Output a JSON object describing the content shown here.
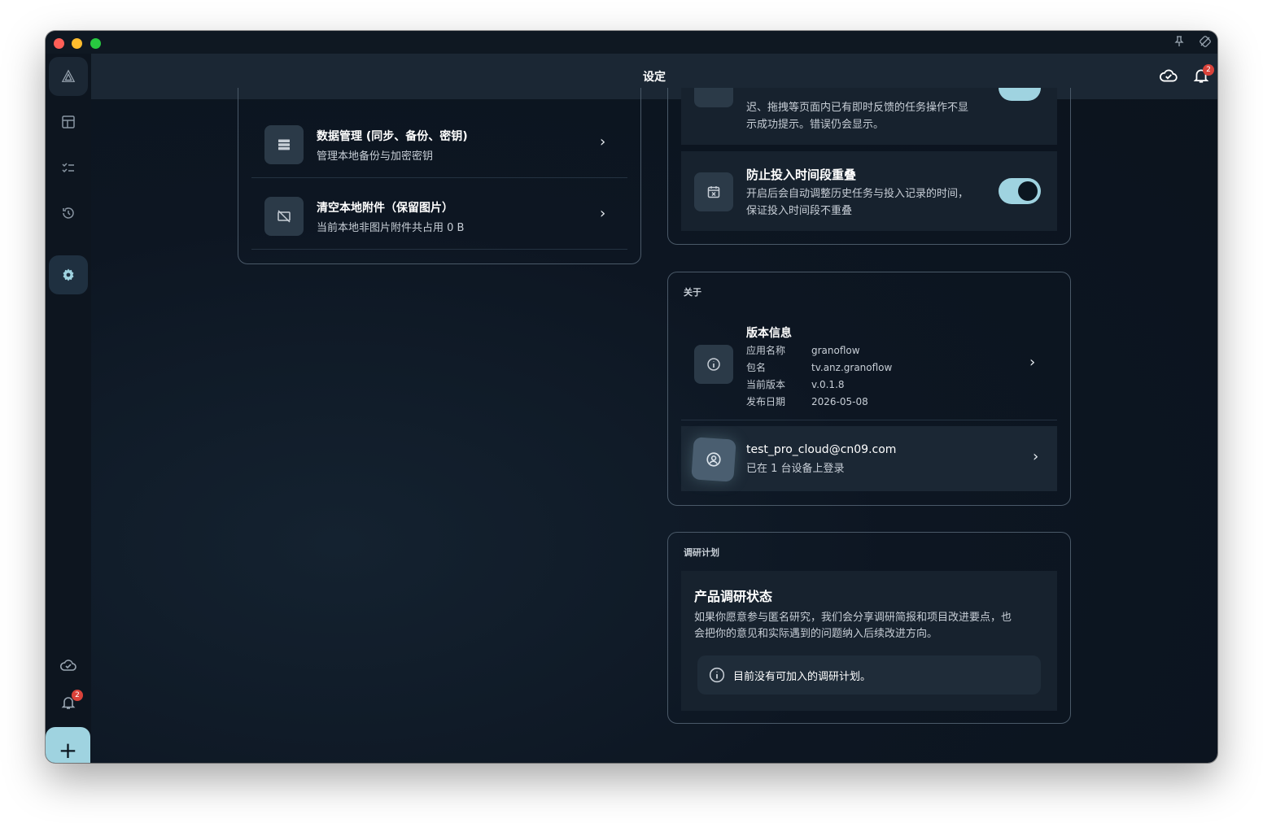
{
  "header": {
    "title": "设定"
  },
  "sidebar": {
    "notification_badge": "2"
  },
  "header_actions": {
    "notification_badge": "2"
  },
  "data_card": {
    "items": [
      {
        "title": "数据管理 (同步、备份、密钥)",
        "subtitle": "管理本地备份与加密密钥"
      },
      {
        "title": "清空本地附件（保留图片）",
        "subtitle": "当前本地非图片附件共占用 0 B"
      }
    ]
  },
  "behavior_card": {
    "partial_item": {
      "line1": "迟、拖拽等页面内已有即时反馈的任务操作不显",
      "line2": "示成功提示。错误仍会显示。"
    },
    "overlap_item": {
      "title": "防止投入时间段重叠",
      "line1": "开启后会自动调整历史任务与投入记录的时间，",
      "line2": "保证投入时间段不重叠",
      "enabled": true
    }
  },
  "about_card": {
    "label": "关于",
    "version": {
      "title": "版本信息",
      "rows": [
        {
          "key": "应用名称",
          "value": "granoflow"
        },
        {
          "key": "包名",
          "value": "tv.anz.granoflow"
        },
        {
          "key": "当前版本",
          "value": "v.0.1.8"
        },
        {
          "key": "发布日期",
          "value": "2026-05-08"
        }
      ]
    },
    "account": {
      "email": "test_pro_cloud@cn09.com",
      "subtitle": "已在 1 台设备上登录"
    }
  },
  "research_card": {
    "label": "调研计划",
    "title": "产品调研状态",
    "line1": "如果你愿意参与匿名研究，我们会分享调研简报和项目改进要点，也",
    "line2": "会把你的意见和实际遇到的问题纳入后续改进方向。",
    "notice": "目前没有可加入的调研计划。"
  },
  "colors": {
    "accent": "#9fd3e0",
    "badge": "#d9423a",
    "card_border": "#4a5968",
    "header": "#1b2734"
  }
}
